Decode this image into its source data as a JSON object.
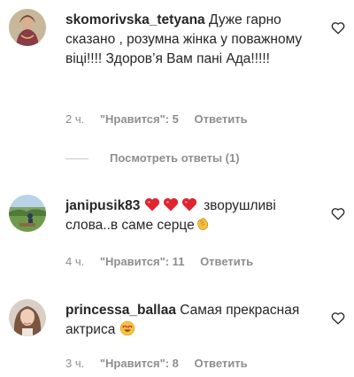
{
  "comments": [
    {
      "username": "skomorivska_tetyana",
      "text": "Дуже гарно сказано , розумна жінка у поважному віці!!!! Здоров’я Вам пані Ада!!!!!",
      "time": "2 ч.",
      "likes": "\"Нравится\": 5",
      "reply": "Ответить",
      "avatar_icon": "avatar-woman-icon",
      "view_replies": "Посмотреть ответы (1)"
    },
    {
      "username": "janipusik83",
      "text_after_hearts": "зворушливі слова..в саме серце",
      "time": "4 ч.",
      "likes": "\"Нравится\": 11",
      "reply": "Ответить",
      "avatar_icon": "avatar-landscape-icon",
      "emojis": [
        "red-heart-icon",
        "red-heart-icon",
        "red-heart-icon",
        "clapping-hand-icon"
      ]
    },
    {
      "username": "princessa_ballaa",
      "text": "Самая прекрасная актриса",
      "time": "3 ч.",
      "likes": "\"Нравится\": 8",
      "reply": "Ответить",
      "avatar_icon": "avatar-girl-icon",
      "emojis": [
        "heart-eyes-face-icon"
      ]
    }
  ],
  "colors": {
    "text": "#262626",
    "secondary": "#8e8e8e",
    "heart": "#ed4956"
  }
}
